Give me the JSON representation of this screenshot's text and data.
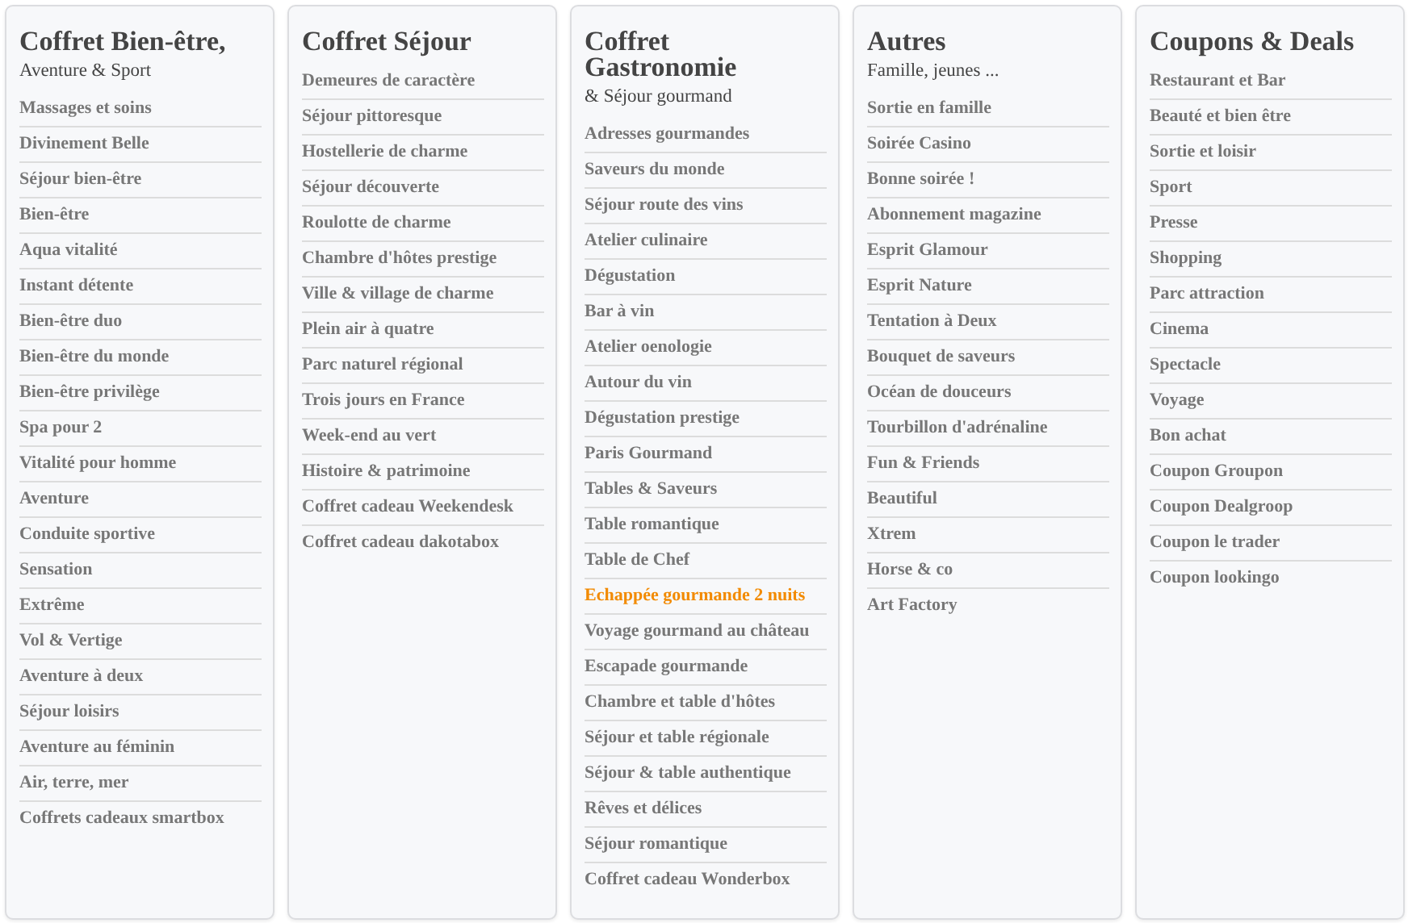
{
  "columns": [
    {
      "title": "Coffret Bien-être,",
      "subtitle": "Aventure & Sport",
      "items": [
        {
          "label": "Massages et soins",
          "selected": false
        },
        {
          "label": "Divinement Belle",
          "selected": false
        },
        {
          "label": "Séjour bien-être",
          "selected": false
        },
        {
          "label": "Bien-être",
          "selected": false
        },
        {
          "label": "Aqua vitalité",
          "selected": false
        },
        {
          "label": "Instant détente",
          "selected": false
        },
        {
          "label": "Bien-être duo",
          "selected": false
        },
        {
          "label": "Bien-être du monde",
          "selected": false
        },
        {
          "label": "Bien-être privilège",
          "selected": false
        },
        {
          "label": "Spa pour 2",
          "selected": false
        },
        {
          "label": "Vitalité pour homme",
          "selected": false
        },
        {
          "label": "Aventure",
          "selected": false
        },
        {
          "label": "Conduite sportive",
          "selected": false
        },
        {
          "label": "Sensation",
          "selected": false
        },
        {
          "label": "Extrême",
          "selected": false
        },
        {
          "label": "Vol & Vertige",
          "selected": false
        },
        {
          "label": "Aventure à deux",
          "selected": false
        },
        {
          "label": "Séjour loisirs",
          "selected": false
        },
        {
          "label": "Aventure au féminin",
          "selected": false
        },
        {
          "label": "Air, terre, mer",
          "selected": false
        },
        {
          "label": "Coffrets cadeaux smartbox",
          "selected": false
        }
      ]
    },
    {
      "title": "Coffret Séjour",
      "items": [
        {
          "label": "Demeures de caractère",
          "selected": false
        },
        {
          "label": "Séjour pittoresque",
          "selected": false
        },
        {
          "label": "Hostellerie de charme",
          "selected": false
        },
        {
          "label": "Séjour découverte",
          "selected": false
        },
        {
          "label": "Roulotte de charme",
          "selected": false
        },
        {
          "label": "Chambre d'hôtes prestige",
          "selected": false
        },
        {
          "label": "Ville & village de charme",
          "selected": false
        },
        {
          "label": "Plein air à quatre",
          "selected": false
        },
        {
          "label": "Parc naturel régional",
          "selected": false
        },
        {
          "label": "Trois jours en France",
          "selected": false
        },
        {
          "label": "Week-end au vert",
          "selected": false
        },
        {
          "label": "Histoire & patrimoine",
          "selected": false
        },
        {
          "label": "Coffret cadeau Weekendesk",
          "selected": false
        },
        {
          "label": "Coffret cadeau dakotabox",
          "selected": false
        }
      ]
    },
    {
      "title": "Coffret Gastronomie",
      "subtitle": "& Séjour gourmand",
      "items": [
        {
          "label": "Adresses gourmandes",
          "selected": false
        },
        {
          "label": "Saveurs du monde",
          "selected": false
        },
        {
          "label": "Séjour route des vins",
          "selected": false
        },
        {
          "label": "Atelier culinaire",
          "selected": false
        },
        {
          "label": "Dégustation",
          "selected": false
        },
        {
          "label": "Bar à vin",
          "selected": false
        },
        {
          "label": "Atelier oenologie",
          "selected": false
        },
        {
          "label": "Autour du vin",
          "selected": false
        },
        {
          "label": "Dégustation prestige",
          "selected": false
        },
        {
          "label": "Paris Gourmand",
          "selected": false
        },
        {
          "label": "Tables & Saveurs",
          "selected": false
        },
        {
          "label": "Table romantique",
          "selected": false
        },
        {
          "label": "Table de Chef",
          "selected": false
        },
        {
          "label": "Echappée gourmande 2 nuits",
          "selected": true
        },
        {
          "label": "Voyage gourmand au château",
          "selected": false
        },
        {
          "label": "Escapade gourmande",
          "selected": false
        },
        {
          "label": "Chambre et table d'hôtes",
          "selected": false
        },
        {
          "label": "Séjour et table régionale",
          "selected": false
        },
        {
          "label": "Séjour & table authentique",
          "selected": false
        },
        {
          "label": "Rêves et délices",
          "selected": false
        },
        {
          "label": "Séjour romantique",
          "selected": false
        },
        {
          "label": "Coffret cadeau Wonderbox",
          "selected": false
        }
      ]
    },
    {
      "title": "Autres",
      "subtitle": "Famille, jeunes ...",
      "items": [
        {
          "label": "Sortie en famille",
          "selected": false
        },
        {
          "label": "Soirée Casino",
          "selected": false
        },
        {
          "label": "Bonne soirée !",
          "selected": false
        },
        {
          "label": "Abonnement magazine",
          "selected": false
        },
        {
          "label": "Esprit Glamour",
          "selected": false
        },
        {
          "label": "Esprit Nature",
          "selected": false
        },
        {
          "label": "Tentation à Deux",
          "selected": false
        },
        {
          "label": "Bouquet de saveurs",
          "selected": false
        },
        {
          "label": "Océan de douceurs",
          "selected": false
        },
        {
          "label": "Tourbillon d'adrénaline",
          "selected": false
        },
        {
          "label": "Fun & Friends",
          "selected": false
        },
        {
          "label": "Beautiful",
          "selected": false
        },
        {
          "label": "Xtrem",
          "selected": false
        },
        {
          "label": "Horse & co",
          "selected": false
        },
        {
          "label": "Art Factory",
          "selected": false
        }
      ]
    },
    {
      "title": "Coupons & Deals",
      "items": [
        {
          "label": "Restaurant et Bar",
          "selected": false
        },
        {
          "label": "Beauté et bien être",
          "selected": false
        },
        {
          "label": "Sortie et loisir",
          "selected": false
        },
        {
          "label": "Sport",
          "selected": false
        },
        {
          "label": "Presse",
          "selected": false
        },
        {
          "label": "Shopping",
          "selected": false
        },
        {
          "label": "Parc attraction",
          "selected": false
        },
        {
          "label": "Cinema",
          "selected": false
        },
        {
          "label": "Spectacle",
          "selected": false
        },
        {
          "label": "Voyage",
          "selected": false
        },
        {
          "label": "Bon achat",
          "selected": false
        },
        {
          "label": "Coupon Groupon",
          "selected": false
        },
        {
          "label": "Coupon Dealgroop",
          "selected": false
        },
        {
          "label": "Coupon le trader",
          "selected": false
        },
        {
          "label": "Coupon lookingo",
          "selected": false
        }
      ]
    }
  ]
}
